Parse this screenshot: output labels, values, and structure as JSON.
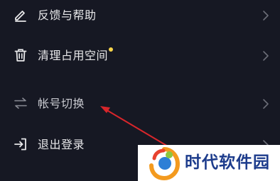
{
  "menu": {
    "items": [
      {
        "label": "反馈与帮助",
        "icon": "edit-pen-icon"
      },
      {
        "label": "清理占用空间",
        "icon": "trash-icon",
        "badge": "new-dot"
      },
      {
        "label": "帐号切换",
        "icon": "switch-arrows-icon"
      },
      {
        "label": "退出登录",
        "icon": "logout-icon"
      }
    ]
  },
  "watermark": {
    "brand": "时代软件园"
  },
  "colors": {
    "background": "#161823",
    "text": "#e8e8ea",
    "badge_dot": "#f8d54a",
    "annotation_arrow": "#d8262b",
    "watermark_text": "#1d3c8c"
  }
}
